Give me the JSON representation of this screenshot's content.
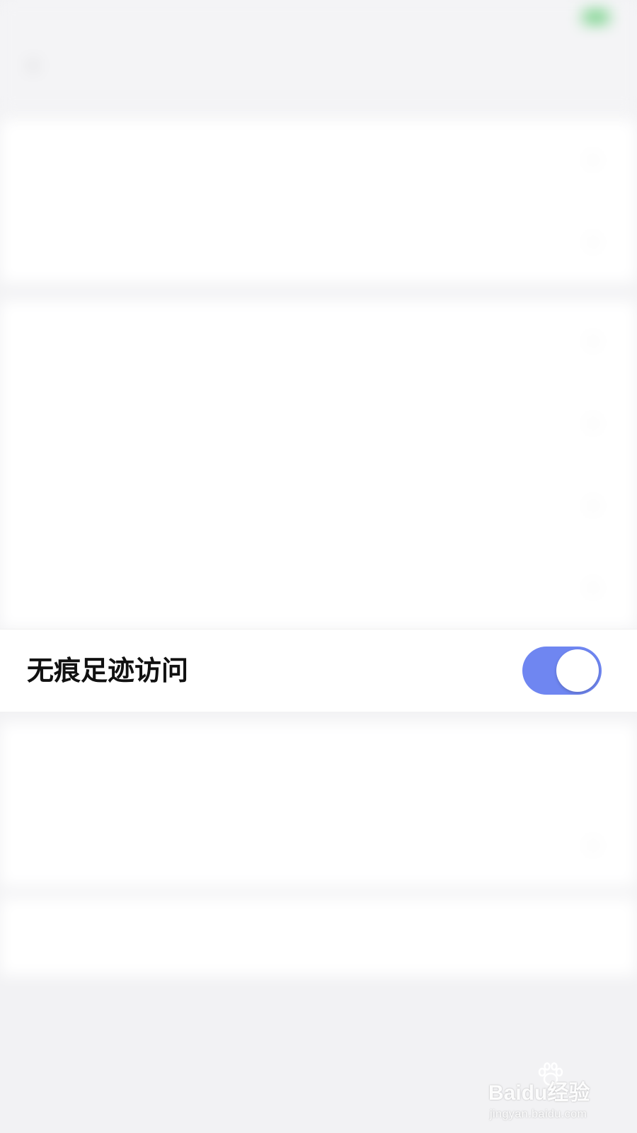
{
  "status_bar": {
    "time": "",
    "carrier": "",
    "battery": ""
  },
  "nav": {
    "title": ""
  },
  "focused_setting": {
    "label": "无痕足迹访问",
    "toggle_on": true,
    "toggle_color": "#6f86f1"
  },
  "watermark": {
    "main": "Baidu经验",
    "sub": "jingyan.baidu.com"
  }
}
